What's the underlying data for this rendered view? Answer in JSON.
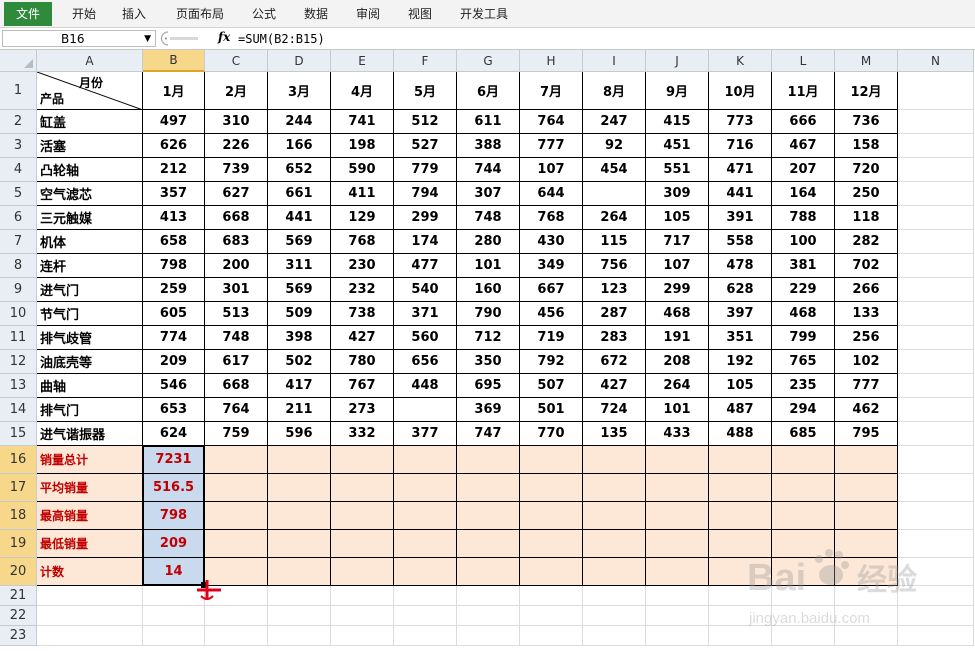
{
  "ribbon": {
    "tabs": [
      "文件",
      "开始",
      "插入",
      "页面布局",
      "公式",
      "数据",
      "审阅",
      "视图",
      "开发工具"
    ]
  },
  "formula_bar": {
    "name_box": "B16",
    "fx_label": "fx",
    "formula": "=SUM(B2:B15)"
  },
  "sheet": {
    "columns": [
      "A",
      "B",
      "C",
      "D",
      "E",
      "F",
      "G",
      "H",
      "I",
      "J",
      "K",
      "L",
      "M",
      "N"
    ],
    "row_numbers": [
      "1",
      "2",
      "3",
      "4",
      "5",
      "6",
      "7",
      "8",
      "9",
      "10",
      "11",
      "12",
      "13",
      "14",
      "15",
      "16",
      "17",
      "18",
      "19",
      "20",
      "21",
      "22",
      "23"
    ],
    "header_top_label": "月份",
    "header_bottom_label": "产品",
    "months": [
      "1月",
      "2月",
      "3月",
      "4月",
      "5月",
      "6月",
      "7月",
      "8月",
      "9月",
      "10月",
      "11月",
      "12月"
    ],
    "rows": [
      {
        "product": "缸盖",
        "values": [
          "497",
          "310",
          "244",
          "741",
          "512",
          "611",
          "764",
          "247",
          "415",
          "773",
          "666",
          "736"
        ]
      },
      {
        "product": "活塞",
        "values": [
          "626",
          "226",
          "166",
          "198",
          "527",
          "388",
          "777",
          "92",
          "451",
          "716",
          "467",
          "158"
        ]
      },
      {
        "product": "凸轮轴",
        "values": [
          "212",
          "739",
          "652",
          "590",
          "779",
          "744",
          "107",
          "454",
          "551",
          "471",
          "207",
          "720"
        ]
      },
      {
        "product": "空气滤芯",
        "values": [
          "357",
          "627",
          "661",
          "411",
          "794",
          "307",
          "644",
          "",
          "309",
          "441",
          "164",
          "250"
        ]
      },
      {
        "product": "三元触媒",
        "values": [
          "413",
          "668",
          "441",
          "129",
          "299",
          "748",
          "768",
          "264",
          "105",
          "391",
          "788",
          "118"
        ]
      },
      {
        "product": "机体",
        "values": [
          "658",
          "683",
          "569",
          "768",
          "174",
          "280",
          "430",
          "115",
          "717",
          "558",
          "100",
          "282"
        ]
      },
      {
        "product": "连杆",
        "values": [
          "798",
          "200",
          "311",
          "230",
          "477",
          "101",
          "349",
          "756",
          "107",
          "478",
          "381",
          "702"
        ]
      },
      {
        "product": "进气门",
        "values": [
          "259",
          "301",
          "569",
          "232",
          "540",
          "160",
          "667",
          "123",
          "299",
          "628",
          "229",
          "266"
        ]
      },
      {
        "product": "节气门",
        "values": [
          "605",
          "513",
          "509",
          "738",
          "371",
          "790",
          "456",
          "287",
          "468",
          "397",
          "468",
          "133"
        ]
      },
      {
        "product": "排气歧管",
        "values": [
          "774",
          "748",
          "398",
          "427",
          "560",
          "712",
          "719",
          "283",
          "191",
          "351",
          "799",
          "256"
        ]
      },
      {
        "product": "油底壳等",
        "values": [
          "209",
          "617",
          "502",
          "780",
          "656",
          "350",
          "792",
          "672",
          "208",
          "192",
          "765",
          "102"
        ]
      },
      {
        "product": "曲轴",
        "values": [
          "546",
          "668",
          "417",
          "767",
          "448",
          "695",
          "507",
          "427",
          "264",
          "105",
          "235",
          "777"
        ]
      },
      {
        "product": "排气门",
        "values": [
          "653",
          "764",
          "211",
          "273",
          "",
          "369",
          "501",
          "724",
          "101",
          "487",
          "294",
          "462"
        ]
      },
      {
        "product": "进气谐振器",
        "values": [
          "624",
          "759",
          "596",
          "332",
          "377",
          "747",
          "770",
          "135",
          "433",
          "488",
          "685",
          "795"
        ]
      }
    ],
    "summary": [
      {
        "label": "销量总计",
        "value": "7231"
      },
      {
        "label": "平均销量",
        "value": "516.5"
      },
      {
        "label": "最高销量",
        "value": "798"
      },
      {
        "label": "最低销量",
        "value": "209"
      },
      {
        "label": "计数",
        "value": "14"
      }
    ]
  },
  "watermark": {
    "brand_left": "Bai",
    "brand_right": "经验",
    "url": "jingyan.baidu.com"
  },
  "colors": {
    "file_tab": "#2f8a3b",
    "summary_fill": "#fde7d6",
    "summary_text": "#c00000",
    "selection_fill": "#c9d9ee",
    "header_selected": "#f7d88a",
    "fill_cursor": "#e0001b"
  }
}
